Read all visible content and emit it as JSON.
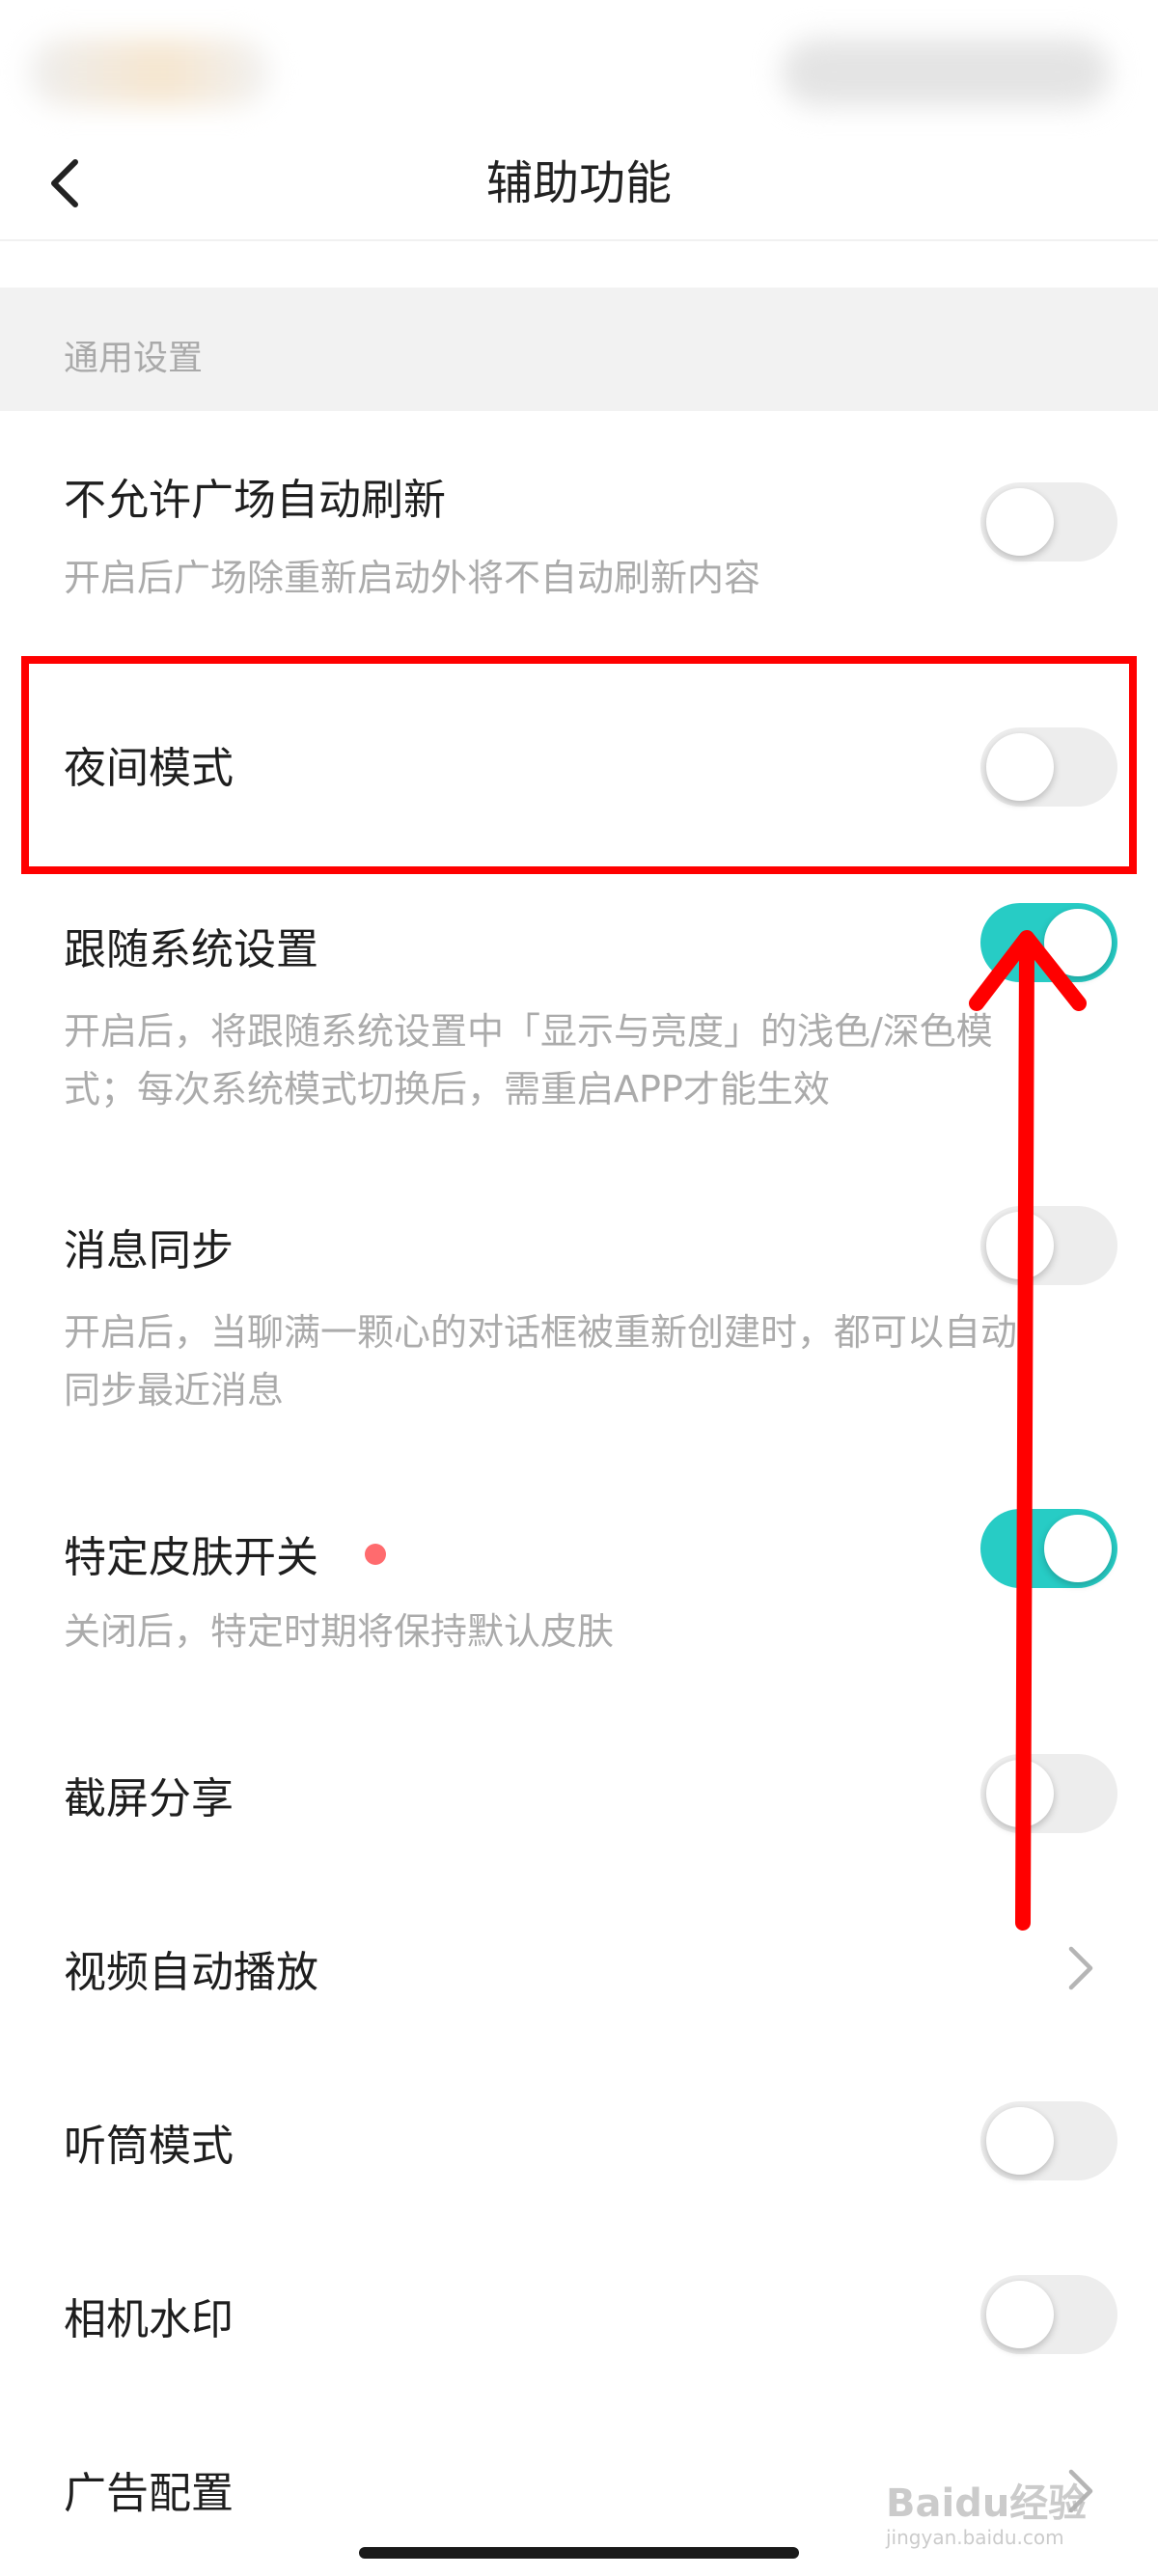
{
  "nav": {
    "title": "辅助功能"
  },
  "section": {
    "title": "通用设置"
  },
  "rows": [
    {
      "title": "不允许广场自动刷新",
      "desc": "开启后广场除重新启动外将不自动刷新内容",
      "control": "toggle",
      "state": "off"
    },
    {
      "title": "夜间模式",
      "control": "toggle",
      "state": "off"
    },
    {
      "title": "跟随系统设置",
      "desc_line1": "开启后，将跟随系统设置中「显示与亮度」的浅色/深色模",
      "desc_line2": "式；每次系统模式切换后，需重启APP才能生效",
      "control": "toggle",
      "state": "on"
    },
    {
      "title": "消息同步",
      "desc_line1": "开启后，当聊满一颗心的对话框被重新创建时，都可以自动",
      "desc_line2": "同步最近消息",
      "control": "toggle",
      "state": "off"
    },
    {
      "title": "特定皮肤开关",
      "desc": "关闭后，特定时期将保持默认皮肤",
      "control": "toggle",
      "state": "on",
      "badge": "red-dot"
    },
    {
      "title": "截屏分享",
      "control": "toggle",
      "state": "off"
    },
    {
      "title": "视频自动播放",
      "control": "chevron"
    },
    {
      "title": "听筒模式",
      "control": "toggle",
      "state": "off"
    },
    {
      "title": "相机水印",
      "control": "toggle",
      "state": "off"
    },
    {
      "title": "广告配置",
      "control": "chevron"
    }
  ],
  "colors": {
    "toggle_on": "#27ccc5",
    "toggle_off": "#ededed",
    "annotation": "#ff0000",
    "badge": "#ff6b6e"
  },
  "watermark": {
    "text": "Baidu经验",
    "sub": "jingyan.baidu.com"
  }
}
